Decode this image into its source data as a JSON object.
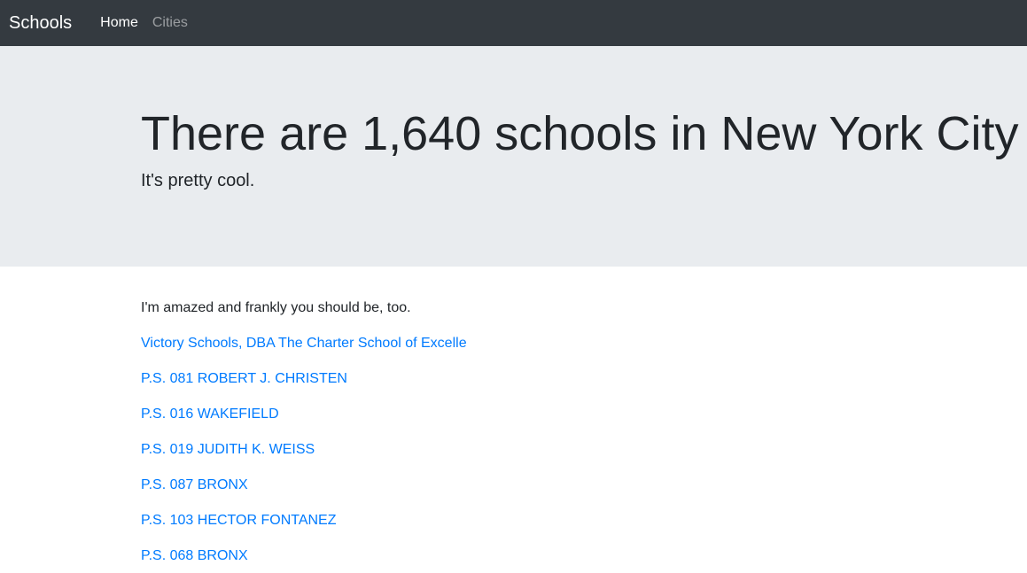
{
  "navbar": {
    "brand": "Schools",
    "links": [
      {
        "label": "Home",
        "active": true
      },
      {
        "label": "Cities",
        "active": false
      }
    ]
  },
  "hero": {
    "title": "There are 1,640 schools in New York City",
    "lead": "It's pretty cool."
  },
  "main": {
    "intro": "I'm amazed and frankly you should be, too.",
    "schools": [
      "Victory Schools, DBA The Charter School of Excelle",
      "P.S. 081 ROBERT J. CHRISTEN",
      "P.S. 016 WAKEFIELD",
      "P.S. 019 JUDITH K. WEISS",
      "P.S. 087 BRONX",
      "P.S. 103 HECTOR FONTANEZ",
      "P.S. 068 BRONX"
    ]
  },
  "colors": {
    "navbar_bg": "#343a40",
    "hero_bg": "#e9ecef",
    "link": "#007bff"
  }
}
